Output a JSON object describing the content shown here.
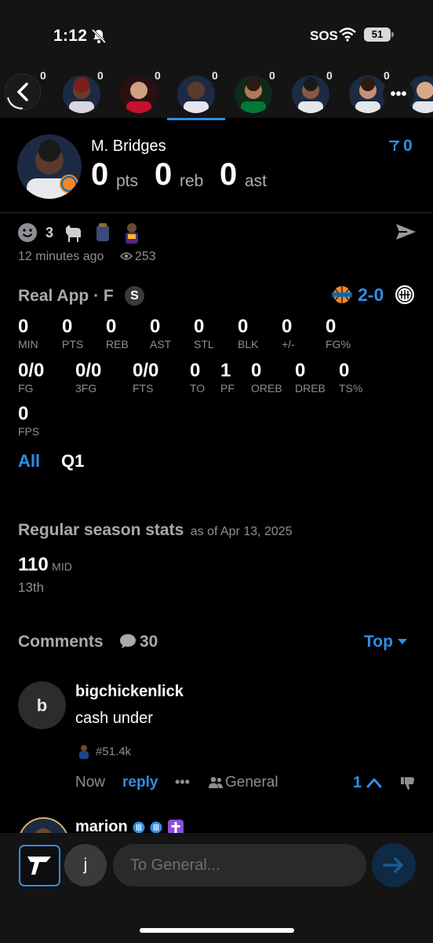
{
  "status": {
    "time": "1:12",
    "sos": "SOS",
    "battery": "51"
  },
  "players_strip": {
    "counts": [
      "0",
      "0",
      "0",
      "0",
      "0",
      "0",
      "0",
      "0"
    ],
    "more_label": "•••"
  },
  "player": {
    "name": "M. Bridges",
    "pts": "0",
    "pts_unit": "pts",
    "reb": "0",
    "reb_unit": "reb",
    "ast": "0",
    "ast_unit": "ast",
    "filter_count": "0"
  },
  "post": {
    "reaction_count": "3",
    "time_ago": "12 minutes ago",
    "views": "253"
  },
  "game": {
    "title": "Real App · F",
    "badge": "S",
    "score": "2-0",
    "stats_row1": [
      {
        "value": "0",
        "label": "MIN"
      },
      {
        "value": "0",
        "label": "PTS"
      },
      {
        "value": "0",
        "label": "REB"
      },
      {
        "value": "0",
        "label": "AST"
      },
      {
        "value": "0",
        "label": "STL"
      },
      {
        "value": "0",
        "label": "BLK"
      },
      {
        "value": "0",
        "label": "+/-"
      },
      {
        "value": "0",
        "label": "FG%"
      }
    ],
    "stats_row2": [
      {
        "value": "0/0",
        "label": "FG"
      },
      {
        "value": "0/0",
        "label": "3FG"
      },
      {
        "value": "0/0",
        "label": "FTS"
      },
      {
        "value": "0",
        "label": "TO"
      },
      {
        "value": "1",
        "label": "PF"
      },
      {
        "value": "0",
        "label": "OREB"
      },
      {
        "value": "0",
        "label": "DREB"
      },
      {
        "value": "0",
        "label": "TS%"
      }
    ],
    "stats_row3": [
      {
        "value": "0",
        "label": "FPS"
      }
    ],
    "periods": [
      "All",
      "Q1"
    ]
  },
  "season": {
    "title": "Regular season stats",
    "as_of": "as of Apr 13, 2025",
    "value": "110",
    "value_label": "MID",
    "rank": "13th"
  },
  "comments": {
    "title": "Comments",
    "count": "30",
    "sort": "Top",
    "items": [
      {
        "initial": "b",
        "user": "bigchickenlick",
        "text": "cash under",
        "tag": "#51.4k",
        "time": "Now",
        "reply": "reply",
        "more": "•••",
        "channel": "General",
        "likes": "1"
      },
      {
        "user": "marion"
      }
    ]
  },
  "composer": {
    "avatar_initial": "j",
    "placeholder": "To General..."
  },
  "colors": {
    "accent": "#2f8ee6",
    "background": "#000000",
    "knicks_orange": "#f58426"
  }
}
